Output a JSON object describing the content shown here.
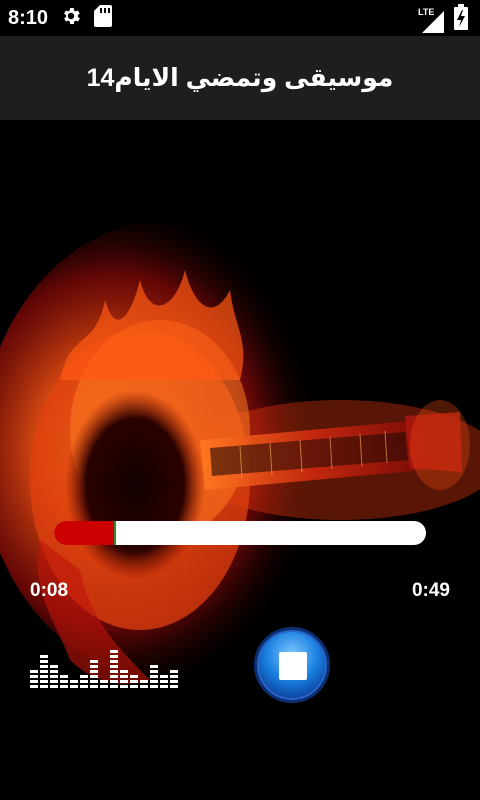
{
  "status_bar": {
    "time": "8:10",
    "icons": [
      "settings-gear-icon",
      "sd-card-icon",
      "lte-signal-icon",
      "battery-charging-icon"
    ],
    "network_label": "LTE"
  },
  "header": {
    "title": "موسيقى وتمضي الايام14"
  },
  "player": {
    "elapsed": "0:08",
    "duration": "0:49",
    "progress_fraction": 0.16,
    "controls": [
      "stop-button"
    ]
  },
  "colors": {
    "progress_fill": "#cc0000",
    "progress_track": "#ffffff",
    "title_bar": "#1e1e1e",
    "button_blue": "#1a7fe0"
  }
}
